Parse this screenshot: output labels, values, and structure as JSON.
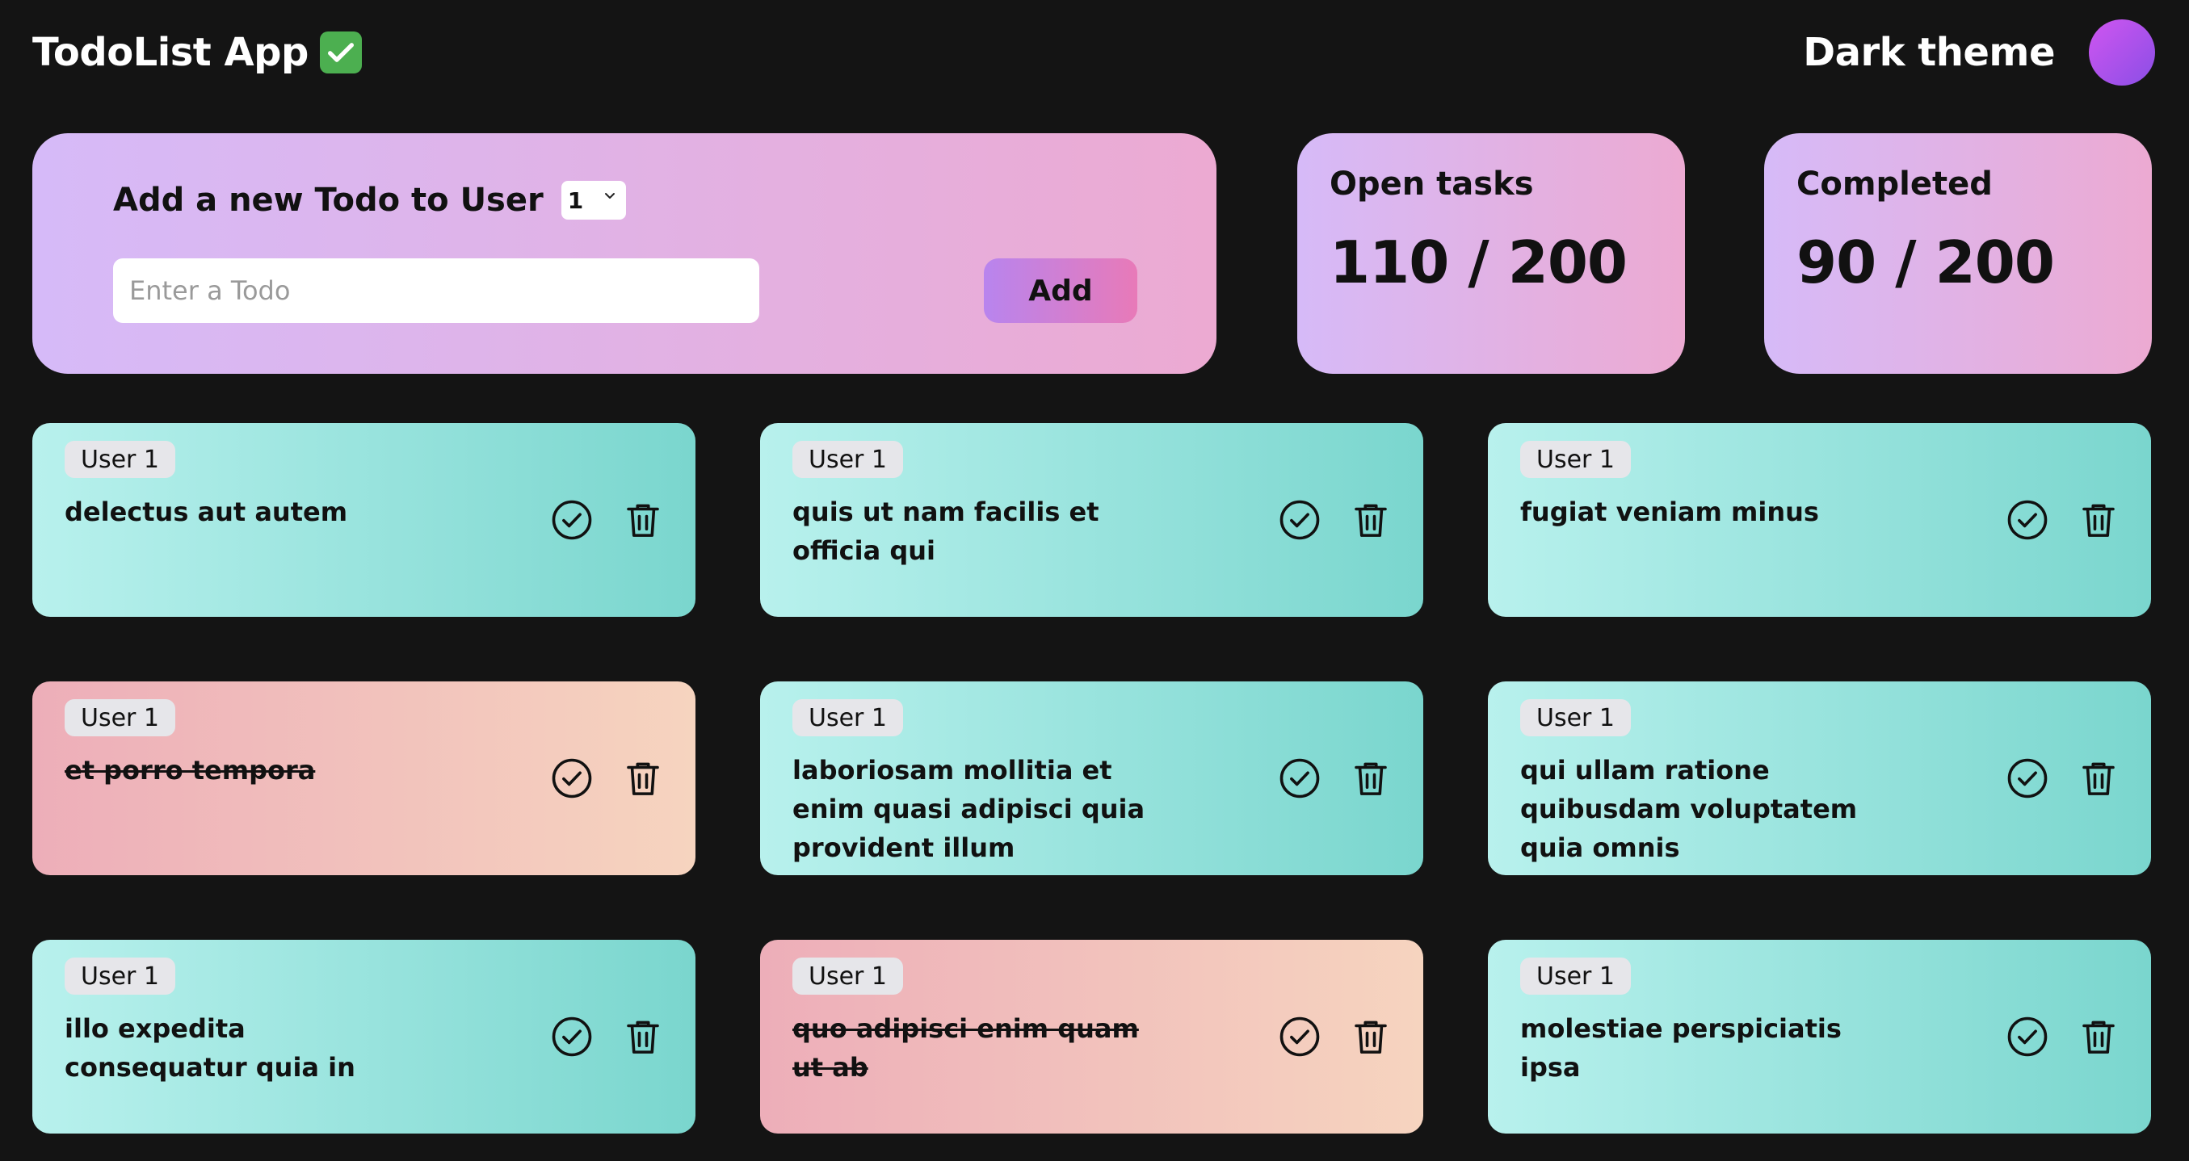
{
  "header": {
    "app_title": "TodoList App",
    "app_title_emoji": "white-heavy-check-mark",
    "theme_label": "Dark theme",
    "theme_toggle_icon": "theme-toggle-circle"
  },
  "add_panel": {
    "heading": "Add a new Todo to User",
    "user_select_value": "1",
    "input_placeholder": "Enter a Todo",
    "input_value": "",
    "add_label": "Add"
  },
  "stats": {
    "open_label": "Open tasks",
    "open_value": "110 / 200",
    "completed_label": "Completed",
    "completed_value": "90 / 200"
  },
  "todos": [
    {
      "user": "User 1",
      "title": "delectus aut autem",
      "completed": false
    },
    {
      "user": "User 1",
      "title": "quis ut nam facilis et officia qui",
      "completed": false
    },
    {
      "user": "User 1",
      "title": "fugiat veniam minus",
      "completed": false
    },
    {
      "user": "User 1",
      "title": "et porro tempora",
      "completed": true
    },
    {
      "user": "User 1",
      "title": "laboriosam mollitia et enim quasi adipisci quia provident illum",
      "completed": false
    },
    {
      "user": "User 1",
      "title": "qui ullam ratione quibusdam voluptatem quia omnis",
      "completed": false
    },
    {
      "user": "User 1",
      "title": "illo expedita consequatur quia in",
      "completed": false
    },
    {
      "user": "User 1",
      "title": "quo adipisci enim quam ut ab",
      "completed": true
    },
    {
      "user": "User 1",
      "title": "molestiae perspiciatis ipsa",
      "completed": false
    }
  ],
  "colors": {
    "background": "#141414",
    "panel_gradient_start": "#d6baf8",
    "panel_gradient_end": "#ecaad2",
    "open_card_start": "#b8f1ed",
    "open_card_end": "#7ad6ce",
    "done_card_start": "#edaeb9",
    "done_card_end": "#f6d4bf"
  }
}
